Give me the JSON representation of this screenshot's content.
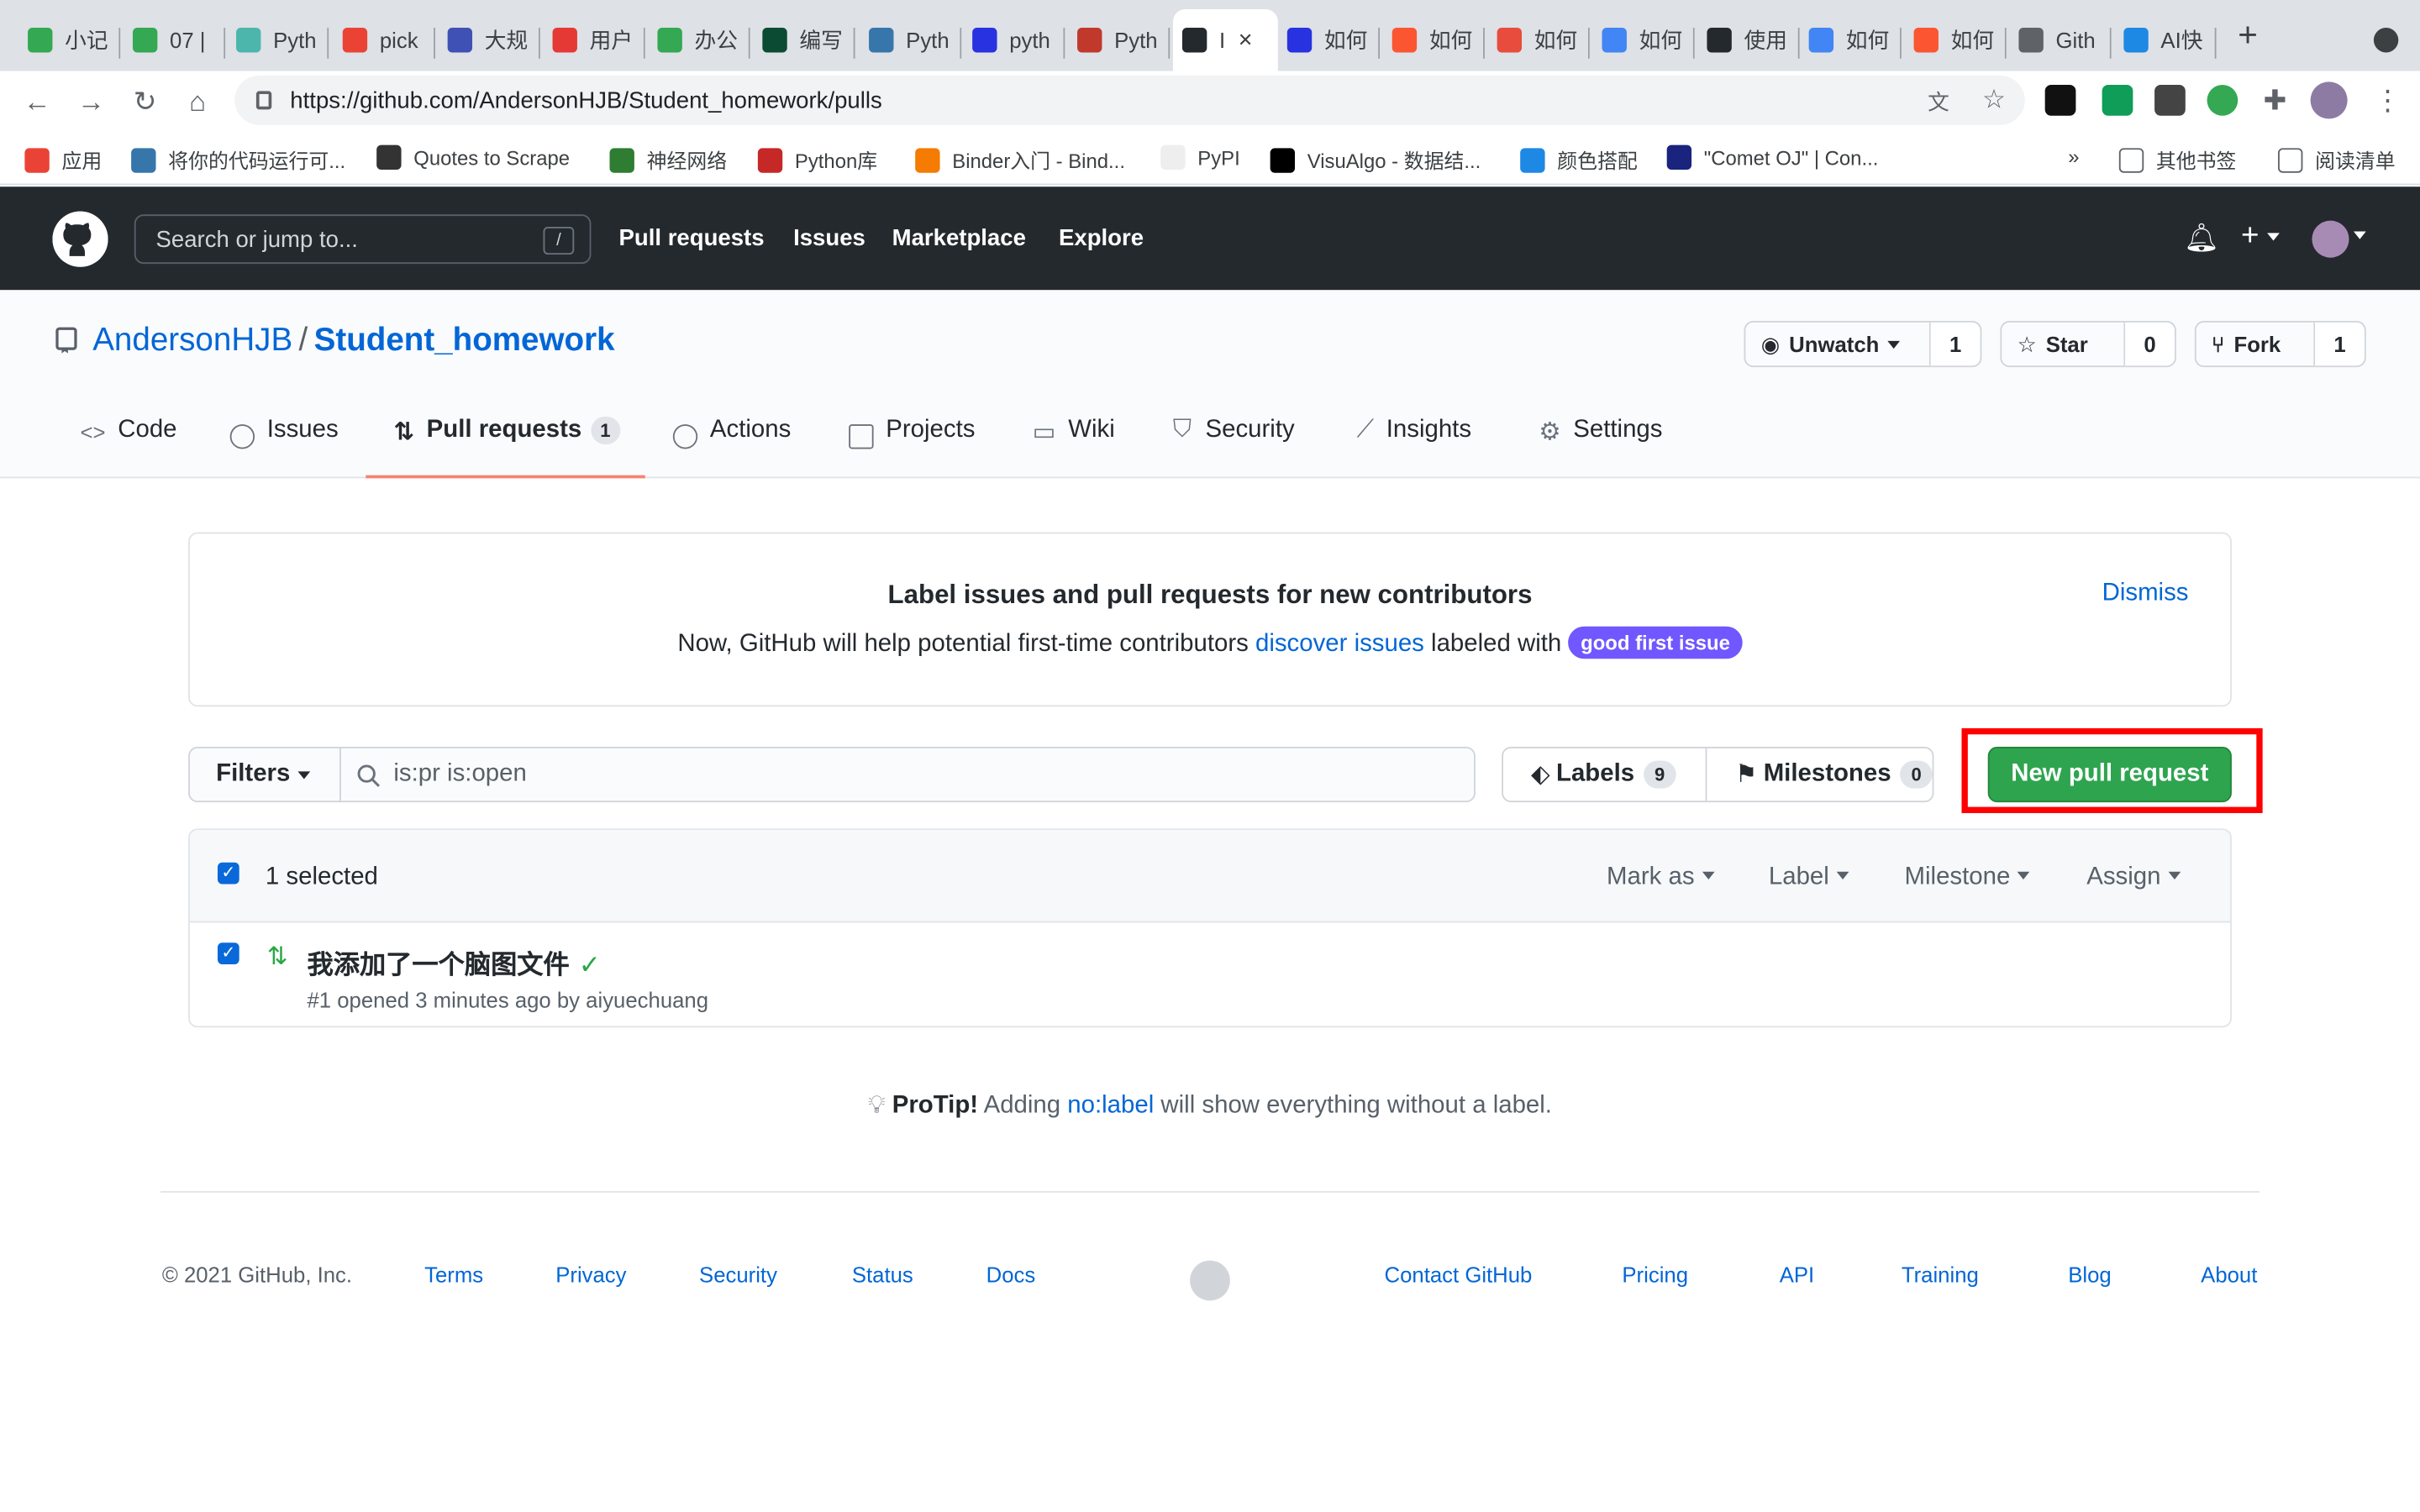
{
  "browser": {
    "tabs": [
      {
        "label": "小记",
        "color": "#34a853"
      },
      {
        "label": "07 |",
        "color": "#34a853"
      },
      {
        "label": "Pyth",
        "color": "#4db6ac"
      },
      {
        "label": "pick",
        "color": "#ea4335"
      },
      {
        "label": "大规",
        "color": "#3f51b5"
      },
      {
        "label": "用户",
        "color": "#e53935"
      },
      {
        "label": "办公",
        "color": "#34a853"
      },
      {
        "label": "编写",
        "color": "#0c4b33"
      },
      {
        "label": "Pyth",
        "color": "#3776ab"
      },
      {
        "label": "pyth",
        "color": "#2932e1"
      },
      {
        "label": "Pyth",
        "color": "#c0392b"
      },
      {
        "label": "I",
        "color": "#24292e",
        "active": true
      },
      {
        "label": "如何",
        "color": "#2932e1"
      },
      {
        "label": "如何",
        "color": "#fc5531"
      },
      {
        "label": "如何",
        "color": "#e74c3c"
      },
      {
        "label": "如何",
        "color": "#4285f4"
      },
      {
        "label": "使用",
        "color": "#24292e"
      },
      {
        "label": "如何",
        "color": "#4285f4"
      },
      {
        "label": "如何",
        "color": "#fc5531"
      },
      {
        "label": "Gith",
        "color": "#5f6368"
      },
      {
        "label": "AI快",
        "color": "#1e88e5"
      }
    ],
    "url": "https://github.com/AndersonHJB/Student_homework/pulls",
    "url_host": "github.com",
    "bookmarks": [
      {
        "label": "应用",
        "color": "#ea4335"
      },
      {
        "label": "将你的代码运行可...",
        "color": "#3776ab"
      },
      {
        "label": "Quotes to Scrape",
        "color": "#333333"
      },
      {
        "label": "神经网络",
        "color": "#2e7d32"
      },
      {
        "label": "Python库",
        "color": "#c62828"
      },
      {
        "label": "Binder入门 - Bind...",
        "color": "#f57c00"
      },
      {
        "label": "PyPI",
        "color": "#eeeeee"
      },
      {
        "label": "VisuAlgo - 数据结...",
        "color": "#000000"
      },
      {
        "label": "颜色搭配",
        "color": "#1e88e5"
      },
      {
        "label": "\"Comet OJ\" | Con...",
        "color": "#1a237e"
      }
    ],
    "bookmarks_more": "»",
    "other_bookmarks": "其他书签",
    "reading_list": "阅读清单"
  },
  "github": {
    "search_placeholder": "Search or jump to...",
    "search_shortcut": "/",
    "nav": [
      "Pull requests",
      "Issues",
      "Marketplace",
      "Explore"
    ],
    "owner": "AndersonHJB",
    "separator": "/",
    "repo": "Student_homework",
    "unwatch": {
      "label": "Unwatch",
      "count": "1"
    },
    "star": {
      "label": "Star",
      "count": "0"
    },
    "fork": {
      "label": "Fork",
      "count": "1"
    },
    "tabs": {
      "code": "Code",
      "issues": "Issues",
      "pulls": "Pull requests",
      "pulls_count": "1",
      "actions": "Actions",
      "projects": "Projects",
      "wiki": "Wiki",
      "security": "Security",
      "insights": "Insights",
      "settings": "Settings"
    },
    "banner": {
      "title": "Label issues and pull requests for new contributors",
      "text_before": "Now, GitHub will help potential first-time contributors",
      "link": "discover issues",
      "text_after": "labeled with",
      "pill": "good first issue",
      "dismiss": "Dismiss"
    },
    "filters_label": "Filters",
    "query": "is:pr is:open",
    "labels": {
      "label": "Labels",
      "count": "9"
    },
    "milestones": {
      "label": "Milestones",
      "count": "0"
    },
    "new_pr": "New pull request",
    "list": {
      "selected": "1 selected",
      "mark_as": "Mark as",
      "label": "Label",
      "milestone": "Milestone",
      "assign": "Assign",
      "pr_title": "我添加了一个脑图文件",
      "pr_meta": "#1 opened 3 minutes ago by aiyuechuang"
    },
    "protip": {
      "bold": "ProTip!",
      "before": "Adding",
      "link": "no:label",
      "after": "will show everything without a label."
    },
    "footer": {
      "copyright": "© 2021 GitHub, Inc.",
      "left_links": [
        "Terms",
        "Privacy",
        "Security",
        "Status",
        "Docs"
      ],
      "right_links": [
        "Contact GitHub",
        "Pricing",
        "API",
        "Training",
        "Blog",
        "About"
      ]
    },
    "colors": {
      "header": "#24292e",
      "primary": "#2ea44f",
      "link": "#0366d6",
      "highlight": "#ff0000",
      "tab_underline": "#f9826c"
    }
  }
}
